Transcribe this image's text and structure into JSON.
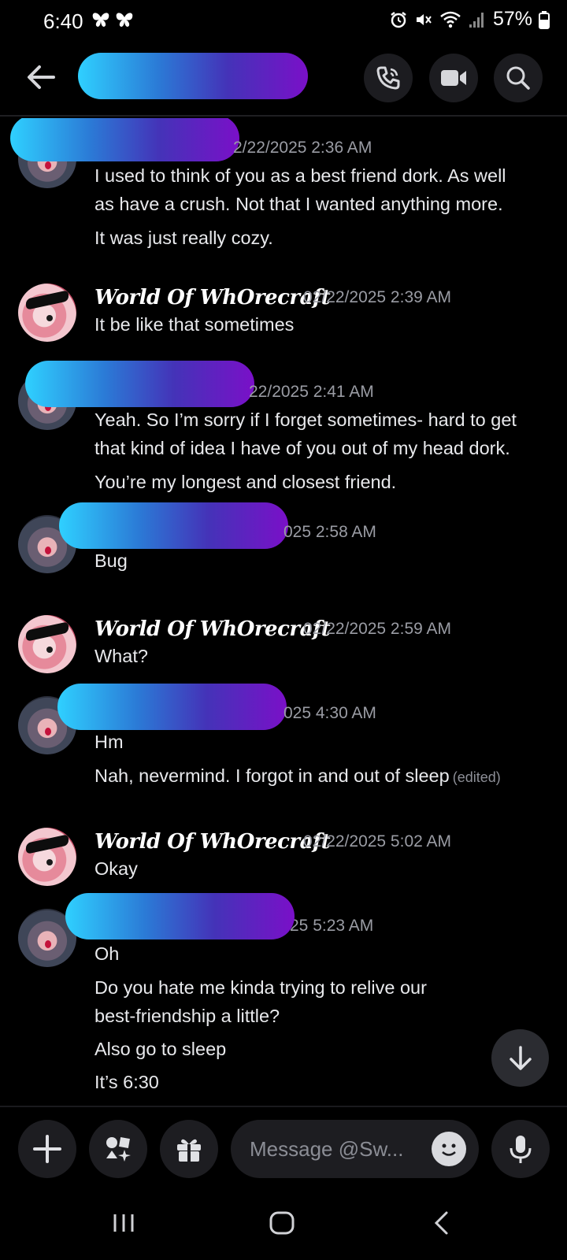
{
  "status_bar": {
    "time": "6:40",
    "battery": "57%"
  },
  "composer": {
    "placeholder": "Message @Sw..."
  },
  "messages": [
    {
      "timestamp": "2/22/2025 2:36 AM",
      "lines": [
        "I used to think of you as a best friend dork. As well",
        "as have a crush. Not that I wanted anything more.",
        "It was just really cozy."
      ]
    },
    {
      "author": "World Of WhOrecraft",
      "timestamp": "02/22/2025 2:39 AM",
      "lines": [
        "It be like that sometimes"
      ]
    },
    {
      "timestamp": "22/2025 2:41 AM",
      "lines": [
        "Yeah. So I’m sorry if I forget sometimes- hard to get",
        "that kind of idea I have of you out of my head dork.",
        "You’re my longest and closest friend."
      ]
    },
    {
      "timestamp": "025 2:58 AM",
      "lines": [
        "Bug"
      ]
    },
    {
      "author": "World Of WhOrecraft",
      "timestamp": "02/22/2025 2:59 AM",
      "lines": [
        "What?"
      ]
    },
    {
      "timestamp": "025 4:30 AM",
      "lines": [
        "Hm",
        "Nah, nevermind. I forgot in and out of sleep"
      ],
      "edited": "(edited)"
    },
    {
      "author": "World Of WhOrecraft",
      "timestamp": "02/22/2025 5:02 AM",
      "lines": [
        "Okay"
      ]
    },
    {
      "timestamp": "25 5:23 AM",
      "lines": [
        "Oh",
        "Do you hate me kinda trying to relive our",
        "best-friendship a little?",
        "Also go to sleep",
        "It’s 6:30"
      ]
    }
  ],
  "colors": {
    "background": "#000000",
    "redaction_gradient": [
      "#2fd0ff",
      "#7a10c8"
    ],
    "timestamp": "#9a9ca4"
  }
}
